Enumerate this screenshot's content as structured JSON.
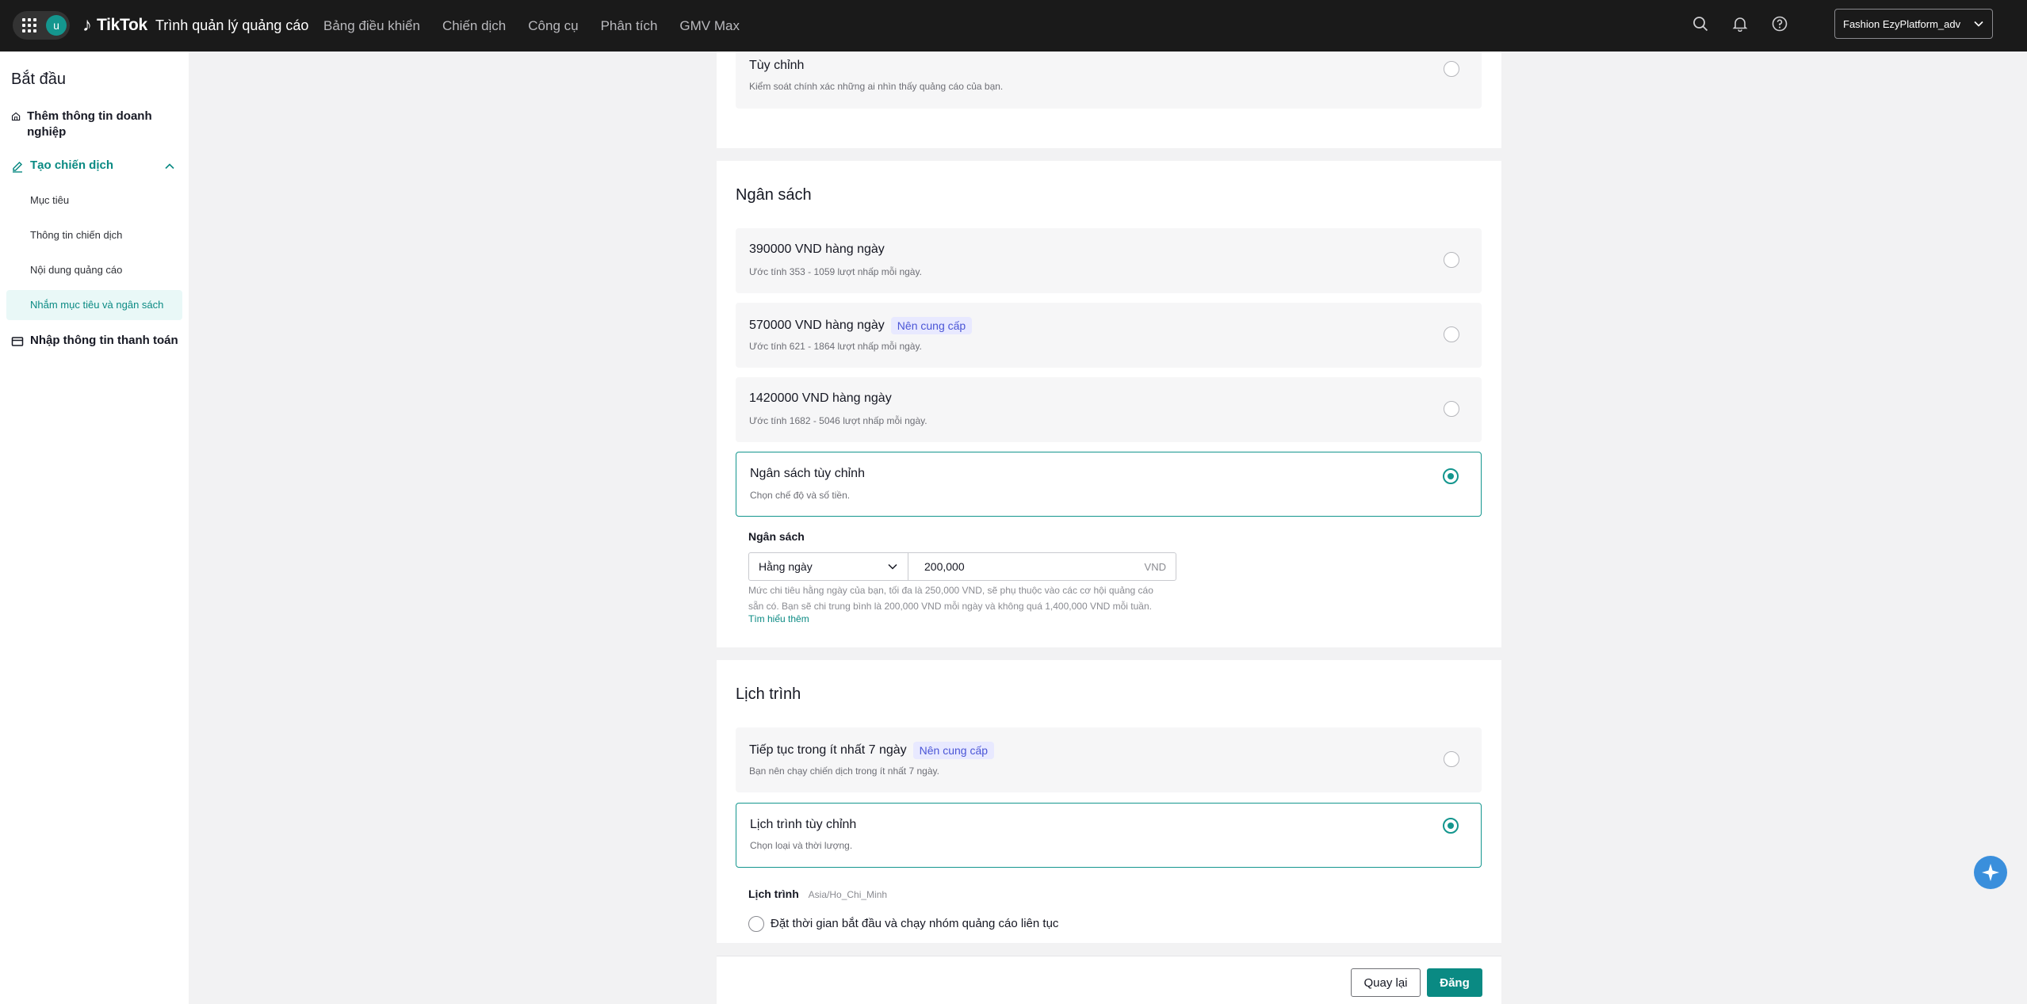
{
  "topbar": {
    "avatar_letter": "u",
    "logo_mark": "♪",
    "logo_brand": "TikTok",
    "logo_sub": "Trình quản lý quảng cáo",
    "nav": [
      "Bảng điều khiển",
      "Chiến dịch",
      "Công cụ",
      "Phân tích",
      "GMV Max"
    ],
    "account_name": "Fashion EzyPlatform_adv"
  },
  "sidebar": {
    "title": "Bắt đầu",
    "business_info": "Thêm thông tin doanh nghiệp",
    "create_campaign": "Tạo chiến dịch",
    "sub_items": [
      "Mục tiêu",
      "Thông tin chiến dịch",
      "Nội dung quảng cáo",
      "Nhắm mục tiêu và ngân sách"
    ],
    "payment": "Nhập thông tin thanh toán"
  },
  "targeting_card": {
    "custom_title": "Tùy chỉnh",
    "custom_desc": "Kiểm soát chính xác những ai nhìn thấy quảng cáo của bạn."
  },
  "budget": {
    "section_title": "Ngân sách",
    "options": [
      {
        "title": "390000 VND hàng ngày",
        "badge": "",
        "desc": "Ước tính 353 - 1059 lượt nhấp mỗi ngày.",
        "selected": false
      },
      {
        "title": "570000 VND hàng ngày",
        "badge": "Nên cung cấp",
        "desc": "Ước tính 621 - 1864 lượt nhấp mỗi ngày.",
        "selected": false
      },
      {
        "title": "1420000 VND hàng ngày",
        "badge": "",
        "desc": "Ước tính 1682 - 5046 lượt nhấp mỗi ngày.",
        "selected": false
      },
      {
        "title": "Ngân sách tùy chỉnh",
        "badge": "",
        "desc": "Chọn chế độ và số tiền.",
        "selected": true
      }
    ],
    "field_label": "Ngân sách",
    "mode_value": "Hằng ngày",
    "amount_value": "200,000",
    "unit": "VND",
    "helper_line1": "Mức chi tiêu hằng ngày của bạn, tối đa là 250,000 VND, sẽ phụ thuộc vào các cơ hội quảng cáo",
    "helper_line2": "sẵn có. Bạn sẽ chi trung bình là 200,000 VND mỗi ngày và không quá 1,400,000 VND mỗi tuần.",
    "learn_more": "Tìm hiểu thêm"
  },
  "schedule": {
    "section_title": "Lịch trình",
    "options": [
      {
        "title": "Tiếp tục trong ít nhất 7 ngày",
        "badge": "Nên cung cấp",
        "desc": "Bạn nên chạy chiến dịch trong ít nhất 7 ngày.",
        "selected": false
      },
      {
        "title": "Lịch trình tùy chỉnh",
        "badge": "",
        "desc": "Chọn loại và thời lượng.",
        "selected": true
      }
    ],
    "field_label": "Lịch trình",
    "timezone": "Asia/Ho_Chi_Minh",
    "continuous_option": "Đặt thời gian bắt đầu và chạy nhóm quảng cáo liên tục"
  },
  "footer": {
    "back_label": "Quay lại",
    "publish_label": "Đăng"
  },
  "colors": {
    "accent": "#14968e",
    "topbar": "#1a1a1a",
    "badge_bg": "#e8e9ff",
    "badge_text": "#4a55d6"
  }
}
